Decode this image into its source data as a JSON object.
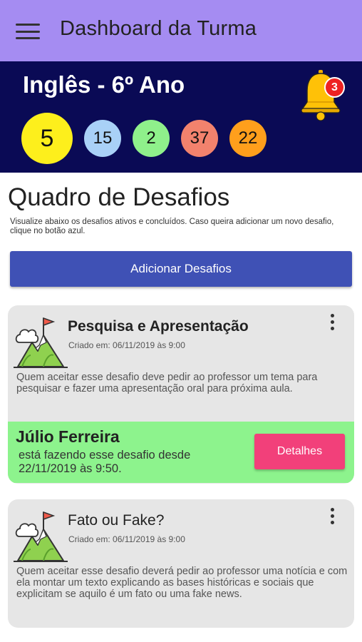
{
  "appbar": {
    "title": "Dashboard da Turma",
    "menu_icon": "hamburger-menu-icon"
  },
  "class_header": {
    "title": "Inglês - 6º Ano",
    "notifications": {
      "icon": "bell-icon",
      "count": "3"
    },
    "stats": [
      {
        "value": "5",
        "color": "#fdef1c"
      },
      {
        "value": "15",
        "color": "#a9d1f7"
      },
      {
        "value": "2",
        "color": "#8ff08b"
      },
      {
        "value": "37",
        "color": "#f2826d"
      },
      {
        "value": "22",
        "color": "#ff9f1c"
      }
    ]
  },
  "board": {
    "title": "Quadro de Desafios",
    "description": "Visualize abaixo os desafios ativos e concluídos. Caso queira adicionar um novo desafio, clique no botão azul.",
    "add_button": "Adicionar Desafios"
  },
  "challenges": [
    {
      "title": "Pesquisa e Apresentação",
      "created": "Criado em: 06/11/2019 às 9:00",
      "description": "Quem aceitar esse desafio deve pedir ao professor um tema para pesquisar e fazer uma apresentação oral para próxima aula.",
      "icon": "mountain-flag-icon",
      "in_progress": {
        "name": "Júlio Ferreira",
        "text": "está fazendo esse desafio desde 22/11/2019 às 9:50.",
        "button": "Detalhes"
      }
    },
    {
      "title": "Fato ou Fake?",
      "created": "Criado em: 06/11/2019 às 9:00",
      "description": "Quem aceitar esse desafio deverá pedir ao professor uma notícia e com ela montar um texto explicando as bases históricas e sociais que explicitam se aquilo é um fato ou uma fake news.",
      "icon": "mountain-flag-icon"
    }
  ],
  "colors": {
    "appbar": "#a58cf2",
    "header": "#0a0a55",
    "primary_button": "#3f51b5",
    "details_button": "#f2407a",
    "progress_bg": "#8df38d",
    "card_bg": "#e6e6e6"
  }
}
